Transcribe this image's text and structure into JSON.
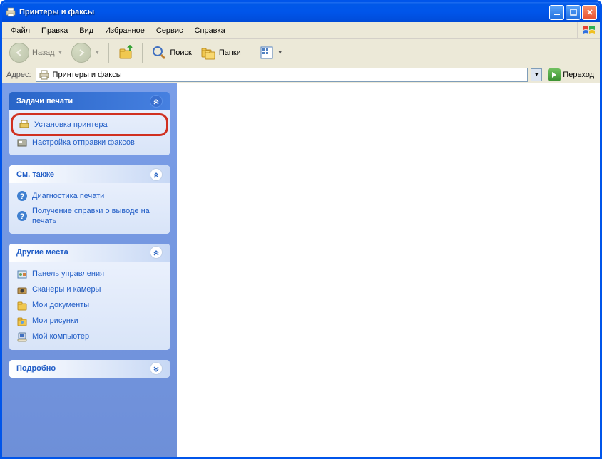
{
  "window": {
    "title": "Принтеры и факсы"
  },
  "menu": {
    "file": "Файл",
    "edit": "Правка",
    "view": "Вид",
    "favorites": "Избранное",
    "tools": "Сервис",
    "help": "Справка"
  },
  "toolbar": {
    "back": "Назад",
    "search": "Поиск",
    "folders": "Папки"
  },
  "address": {
    "label": "Адрес:",
    "value": "Принтеры и факсы",
    "go": "Переход"
  },
  "panels": {
    "print_tasks": {
      "title": "Задачи печати",
      "add_printer": "Установка принтера",
      "fax_setup": "Настройка отправки факсов"
    },
    "see_also": {
      "title": "См. также",
      "troubleshoot": "Диагностика печати",
      "get_help": "Получение справки о выводе на печать"
    },
    "other_places": {
      "title": "Другие места",
      "control_panel": "Панель управления",
      "scanners": "Сканеры и камеры",
      "my_documents": "Мои документы",
      "my_pictures": "Мои рисунки",
      "my_computer": "Мой компьютер"
    },
    "details": {
      "title": "Подробно"
    }
  }
}
